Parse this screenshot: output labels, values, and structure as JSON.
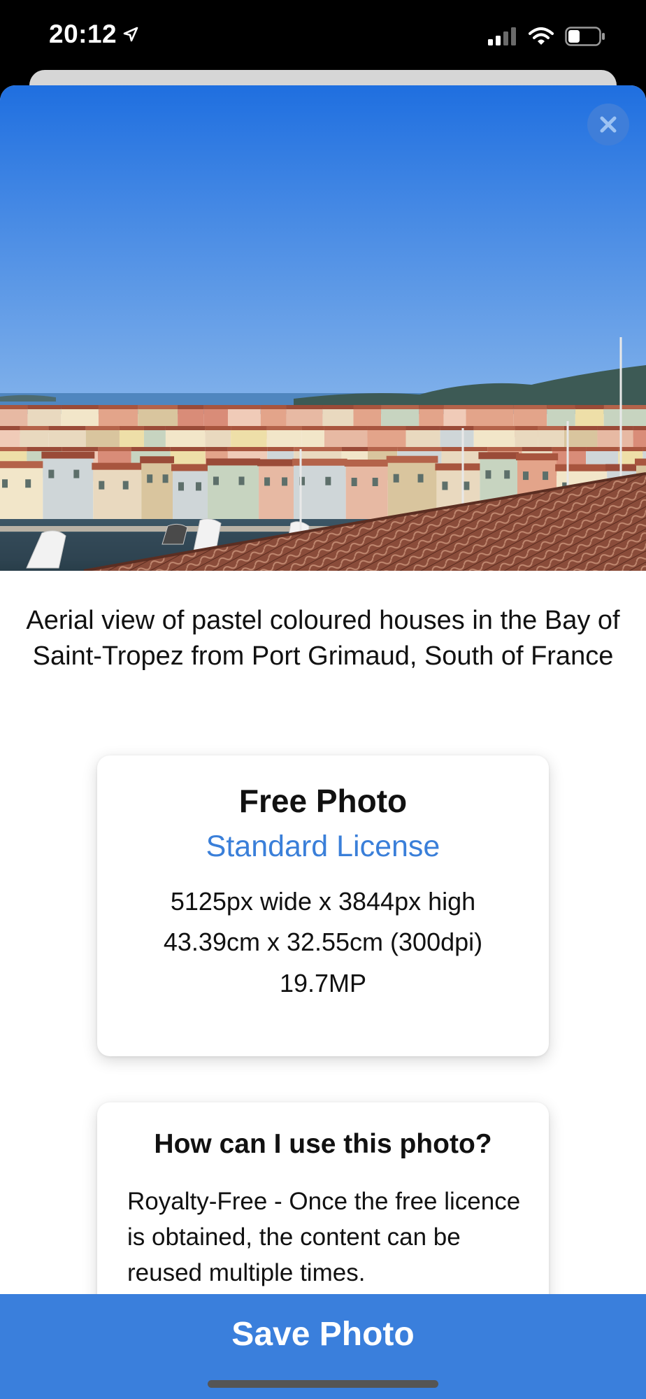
{
  "status_bar": {
    "time": "20:12",
    "icons": [
      "location-arrow-icon",
      "cellular-signal-icon",
      "wifi-icon",
      "battery-icon"
    ]
  },
  "photo": {
    "caption": "Aerial view of pastel coloured houses in the Bay of Saint-Tropez from Port Grimaud, South of France",
    "close_icon": "close-icon"
  },
  "license_card": {
    "title": "Free Photo",
    "license_type": "Standard License",
    "dimensions_px": "5125px wide x 3844px high",
    "dimensions_cm": "43.39cm x 32.55cm (300dpi)",
    "megapixels": "19.7MP"
  },
  "usage_card": {
    "title": "How can I use this photo?",
    "body": "Royalty-Free - Once the free licence is obtained, the content can be reused multiple times."
  },
  "save_button": {
    "label": "Save Photo"
  },
  "colors": {
    "accent": "#3a7fdc",
    "license_link": "#3a7fd9",
    "sky": "#2f7ae0"
  }
}
